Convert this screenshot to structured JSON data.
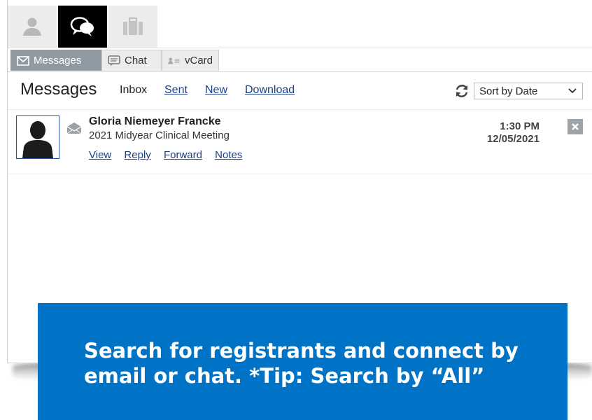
{
  "top_icons": [
    {
      "name": "person-icon",
      "active": false
    },
    {
      "name": "chat-bubbles-icon",
      "active": true
    },
    {
      "name": "briefcase-icon",
      "active": false
    }
  ],
  "subtabs": {
    "messages": "Messages",
    "chat": "Chat",
    "vcard": "vCard"
  },
  "header": {
    "title": "Messages",
    "inbox": "Inbox",
    "sent": "Sent",
    "new": "New",
    "download": "Download",
    "sort_selected": "Sort by Date"
  },
  "messages": [
    {
      "sender": "Gloria Niemeyer Francke",
      "subject": "2021 Midyear Clinical Meeting",
      "time": "1:30 PM",
      "date": "12/05/2021",
      "actions": {
        "view": "View",
        "reply": "Reply",
        "forward": "Forward",
        "notes": "Notes"
      }
    }
  ],
  "banner": {
    "line1": "Search for registrants and connect by",
    "line2": "email or chat. *Tip: Search by “All”"
  },
  "colors": {
    "active_tab": "#8f9aa3",
    "link": "#1a3f86",
    "banner": "#0073c6"
  }
}
